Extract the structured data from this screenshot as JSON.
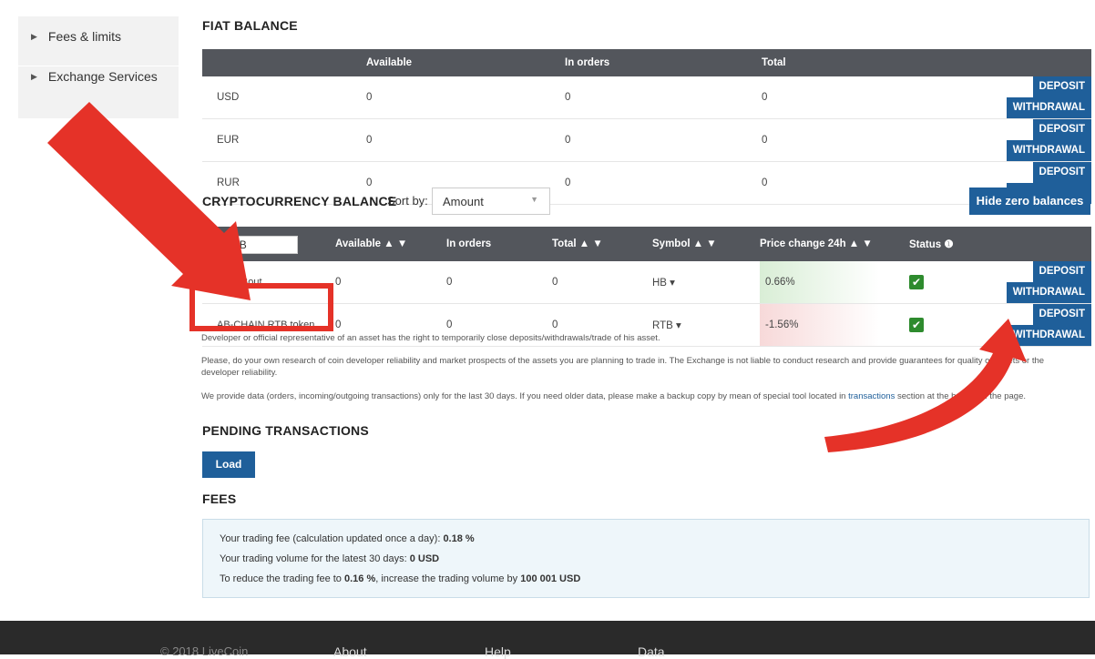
{
  "sidebar": {
    "items": [
      {
        "label": "Fees & limits"
      },
      {
        "label": "Exchange Services"
      }
    ]
  },
  "fiat": {
    "title": "FIAT BALANCE",
    "columns": [
      "",
      "Available",
      "In orders",
      "Total"
    ],
    "rows": [
      {
        "currency": "USD",
        "available": "0",
        "in_orders": "0",
        "total": "0"
      },
      {
        "currency": "EUR",
        "available": "0",
        "in_orders": "0",
        "total": "0"
      },
      {
        "currency": "RUR",
        "available": "0",
        "in_orders": "0",
        "total": "0"
      }
    ],
    "deposit_label": "DEPOSIT",
    "withdrawal_label": "WITHDRAWAL"
  },
  "crypto": {
    "title": "CRYPTOCURRENCY BALANCE",
    "sort_by_label": "Sort by:",
    "sort_value": "Amount",
    "hide_zero_label": "Hide zero balances",
    "filter_value": "RTB",
    "columns": [
      "Available ▲ ▼",
      "In orders",
      "Total ▲ ▼",
      "Symbol ▲ ▼",
      "Price change 24h ▲ ▼",
      "Status ❶"
    ],
    "rows": [
      {
        "name": "HeartBout",
        "available": "0",
        "in_orders": "0",
        "total": "0",
        "symbol": "HB ▾",
        "price_change": "0.66%",
        "trend": "up"
      },
      {
        "name": "AB-CHAIN RTB token",
        "available": "0",
        "in_orders": "0",
        "total": "0",
        "symbol": "RTB ▾",
        "price_change": "-1.56%",
        "trend": "down"
      }
    ],
    "deposit_label": "DEPOSIT",
    "withdrawal_label": "WITHDRAWAL"
  },
  "notes": {
    "line1": "Developer or official representative of an asset has the right to temporarily close deposits/withdrawals/trade of his asset.",
    "line2": "Please, do your own research of coin developer reliability and market prospects of the assets you are planning to trade in. The Exchange is not liable to conduct research and provide guarantees for quality of assets or the developer reliability.",
    "line3_a": "We provide data (orders, incoming/outgoing transactions) only for the last 30 days. If you need older data, please make a backup copy by mean of special tool located in ",
    "line3_link": "transactions",
    "line3_b": " section at the bottom of the page."
  },
  "pending": {
    "title": "PENDING TRANSACTIONS",
    "load_label": "Load"
  },
  "fees": {
    "title": "FEES",
    "line1_prefix": "Your trading fee (calculation updated once a day): ",
    "line1_value": "0.18 %",
    "line2_prefix": "Your trading volume for the latest 30 days: ",
    "line2_value": "0 USD",
    "line3_prefix": "To reduce the trading fee to ",
    "line3_value1": "0.16 %",
    "line3_mid": ", increase the trading volume by ",
    "line3_value2": "100 001 USD"
  },
  "footer": {
    "copyright": "© 2018 LiveCoin",
    "about": "About",
    "help": "Help",
    "data": "Data"
  },
  "colors": {
    "accent": "#1f5f9a",
    "header": "#53565c",
    "annotation": "#e53228",
    "status_ok": "#2e8b2e"
  }
}
